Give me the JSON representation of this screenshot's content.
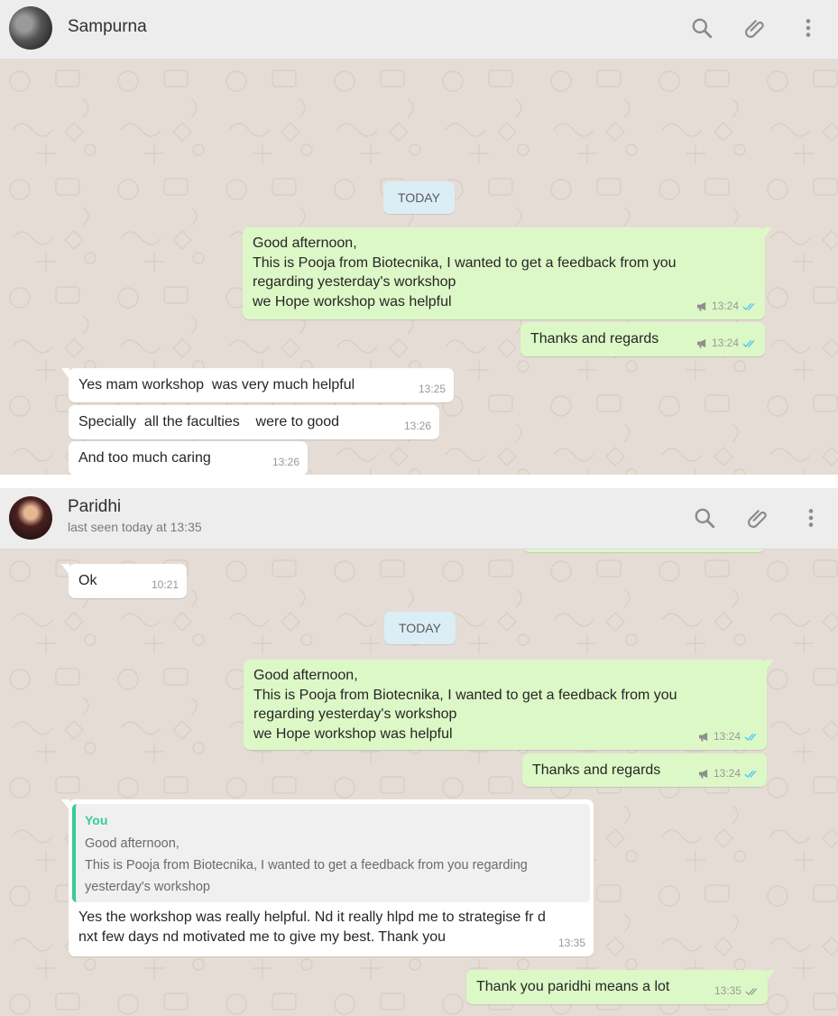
{
  "conversations": [
    {
      "contact": {
        "name": "Sampurna",
        "status": ""
      },
      "date_separator": "TODAY",
      "messages": [
        {
          "direction": "out",
          "text": "Good afternoon,\nThis is Pooja from Biotecnika, I wanted to get a feedback from you\nregarding yesterday's workshop\nwe Hope workshop was helpful",
          "time": "13:24"
        },
        {
          "direction": "out",
          "text": "Thanks and regards",
          "time": "13:24"
        },
        {
          "direction": "in",
          "text": "Yes mam workshop  was very much helpful",
          "time": "13:25"
        },
        {
          "direction": "in",
          "text": "Specially  all the faculties    were to good",
          "time": "13:26"
        },
        {
          "direction": "in",
          "text": "And too much caring",
          "time": "13:26"
        }
      ]
    },
    {
      "contact": {
        "name": "Paridhi",
        "status": "last seen today at 13:35"
      },
      "date_separator": "TODAY",
      "messages": [
        {
          "direction": "in",
          "text": "Ok",
          "time": "10:21"
        },
        {
          "direction": "out",
          "text": "Good afternoon,\nThis is Pooja from Biotecnika, I wanted to get a feedback from you\nregarding yesterday's workshop\nwe Hope workshop was helpful",
          "time": "13:24"
        },
        {
          "direction": "out",
          "text": "Thanks and regards",
          "time": "13:24"
        },
        {
          "direction": "in",
          "quoted_author": "You",
          "quoted_text": "Good afternoon,\nThis is Pooja from Biotecnika, I wanted to get a feedback from you regarding\nyesterday's workshop",
          "text": "Yes the workshop was really helpful. Nd it really hlpd me to strategise fr d\nnxt few days nd motivated me to give my best. Thank you",
          "time": "13:35"
        },
        {
          "direction": "out",
          "text": "Thank you paridhi means a lot",
          "time": "13:35"
        }
      ]
    }
  ],
  "icons": {
    "search": "search-icon",
    "attach": "paperclip-icon",
    "menu": "more-vertical-icon",
    "broadcast": "megaphone-icon",
    "read_receipt": "double-check-icon"
  },
  "colors": {
    "outgoing_bubble": "#dcf8c6",
    "incoming_bubble": "#ffffff",
    "chat_background": "#e5ddd5",
    "header_background": "#ededed",
    "read_ticks": "#4fc3f7",
    "sent_ticks": "#999999",
    "quote_accent": "#35cd96",
    "date_pill": "#dbeef6"
  }
}
